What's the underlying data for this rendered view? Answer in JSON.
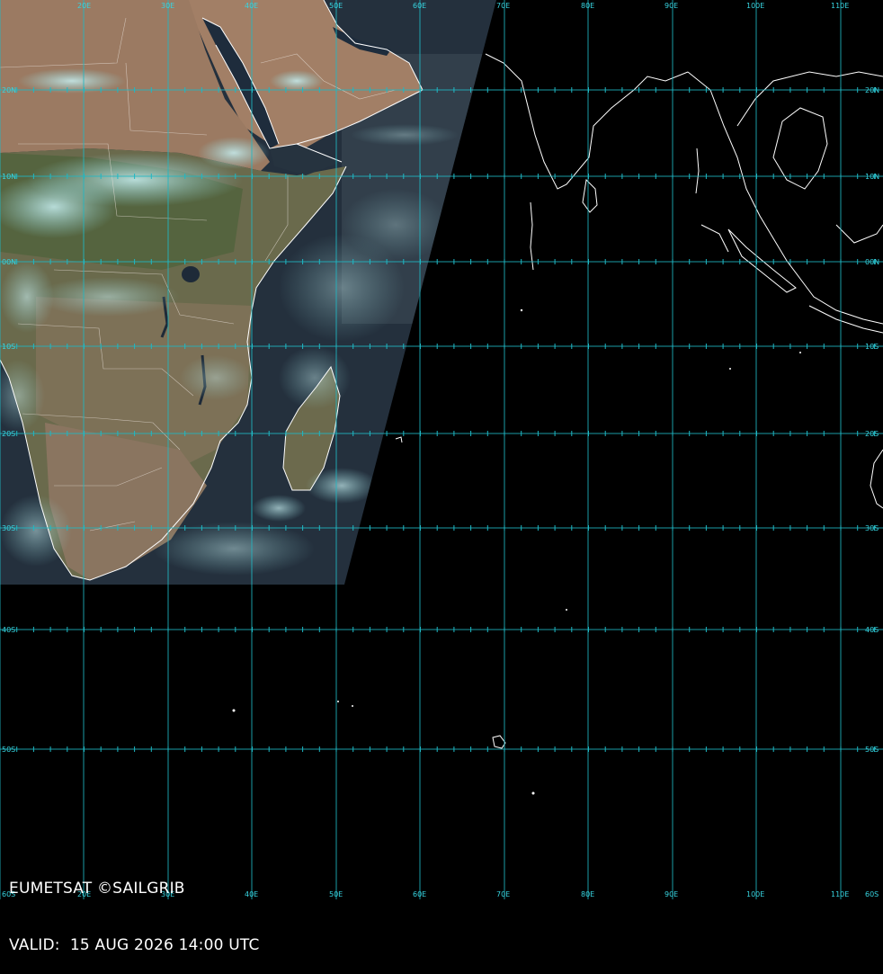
{
  "caption": {
    "source": "EUMETSAT ©SAILGRIB",
    "valid": "VALID:  15 AUG 2026 14:00 UTC"
  },
  "colors": {
    "grid": "#1fb8c4",
    "coastline": "#ffffff",
    "background": "#000000",
    "land_desert": "#9a7a63",
    "land_vegetated": "#5f6a45",
    "ocean": "#22303f",
    "cloud": "#8fd8dc"
  },
  "grid": {
    "longitude_labels": [
      "20E",
      "30E",
      "40E",
      "50E",
      "60E",
      "70E",
      "80E",
      "90E",
      "100E",
      "110E"
    ],
    "latitude_labels": [
      "20N",
      "10N",
      "00N",
      "10S",
      "20S",
      "30S",
      "40S",
      "50S",
      "60S"
    ]
  }
}
